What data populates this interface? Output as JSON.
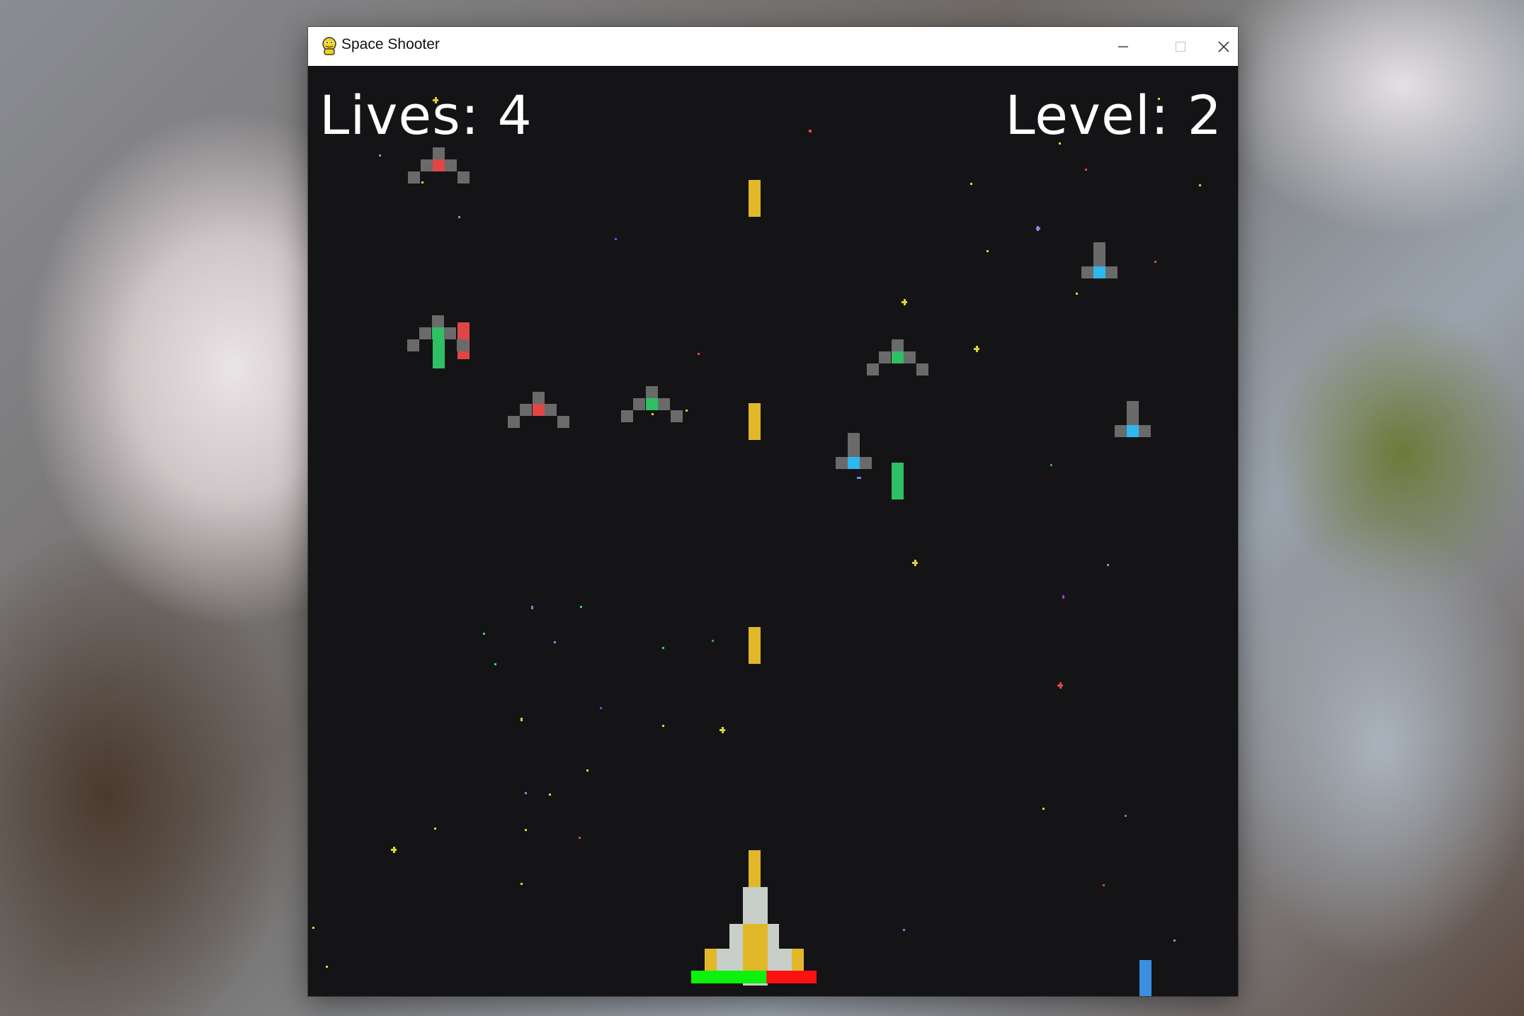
{
  "window": {
    "title": "Space Shooter",
    "controls": {
      "minimize": "minimize-icon",
      "maximize": "maximize-icon",
      "close": "close-icon"
    }
  },
  "hud": {
    "lives_text": "Lives: 4",
    "lives": 4,
    "level_text": "Level: 2",
    "level": 2
  },
  "player": {
    "health_fraction": 0.6,
    "health_color": "#0cf20c",
    "damage_color": "#ff1111",
    "body_color": "#c8cfc8",
    "accent_color": "#e1b82a"
  },
  "enemy_types": {
    "red": "#e14646",
    "green": "#2fbf64",
    "blue": "#2eb8f0",
    "hull": "#6a6a6a"
  },
  "colors": {
    "background": "#141315",
    "player_laser": "#e1b82a",
    "blue_laser": "#3a8fe0"
  }
}
